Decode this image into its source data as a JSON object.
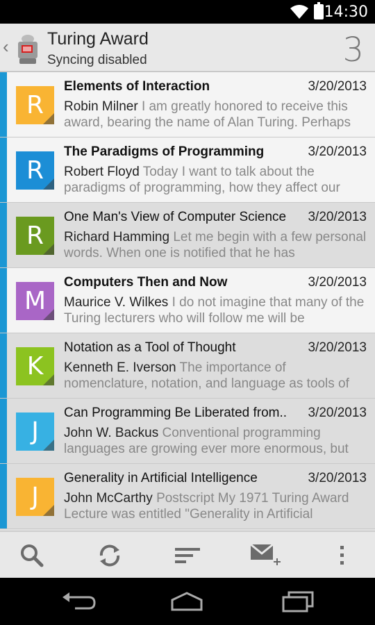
{
  "status_bar": {
    "time": "14:30"
  },
  "header": {
    "title": "Turing Award",
    "subtitle": "Syncing disabled",
    "count": "3"
  },
  "messages": [
    {
      "initial": "R",
      "avatar_color": "#f9b433",
      "subject": "Elements of Interaction",
      "date": "3/20/2013",
      "sender": "Robin Milner",
      "preview": "I am greatly honored to receive this award, bearing the name of Alan Turing. Perhaps",
      "unread": true
    },
    {
      "initial": "R",
      "avatar_color": "#1c8ed6",
      "subject": "The Paradigms of Programming",
      "date": "3/20/2013",
      "sender": "Robert Floyd",
      "preview": "Today I want to talk about the paradigms of programming, how they affect our",
      "unread": true
    },
    {
      "initial": "R",
      "avatar_color": "#6a9a1f",
      "subject": "One Man's View of Computer Science",
      "date": "3/20/2013",
      "sender": "Richard Hamming",
      "preview": "Let me begin with a few personal words. When one is notified that he has",
      "unread": false
    },
    {
      "initial": "M",
      "avatar_color": "#a966c6",
      "subject": "Computers Then and Now",
      "date": "3/20/2013",
      "sender": "Maurice V. Wilkes",
      "preview": "I do not imagine that many of the Turing lecturers who will follow me will be",
      "unread": true
    },
    {
      "initial": "K",
      "avatar_color": "#8cc320",
      "subject": "Notation as a Tool of Thought",
      "date": "3/20/2013",
      "sender": "Kenneth E. Iverson",
      "preview": "The importance of nomenclature, notation, and language as tools of",
      "unread": false
    },
    {
      "initial": "J",
      "avatar_color": "#37b1e3",
      "subject": "Can Programming Be Liberated from..",
      "date": "3/20/2013",
      "sender": "John W. Backus",
      "preview": "Conventional programming languages are growing ever more enormous, but",
      "unread": false
    },
    {
      "initial": "J",
      "avatar_color": "#f9b433",
      "subject": "Generality in Artificial Intelligence",
      "date": "3/20/2013",
      "sender": "John McCarthy",
      "preview": "Postscript My 1971 Turing Award Lecture was entitled \"Generality in Artificial",
      "unread": false
    }
  ],
  "toolbar_icons": [
    "search-icon",
    "refresh-icon",
    "sort-icon",
    "compose-icon",
    "overflow-menu-icon"
  ],
  "nav_icons": [
    "back-icon",
    "home-icon",
    "recents-icon"
  ],
  "colors": {
    "accent_stripe": "#1b97d4"
  }
}
